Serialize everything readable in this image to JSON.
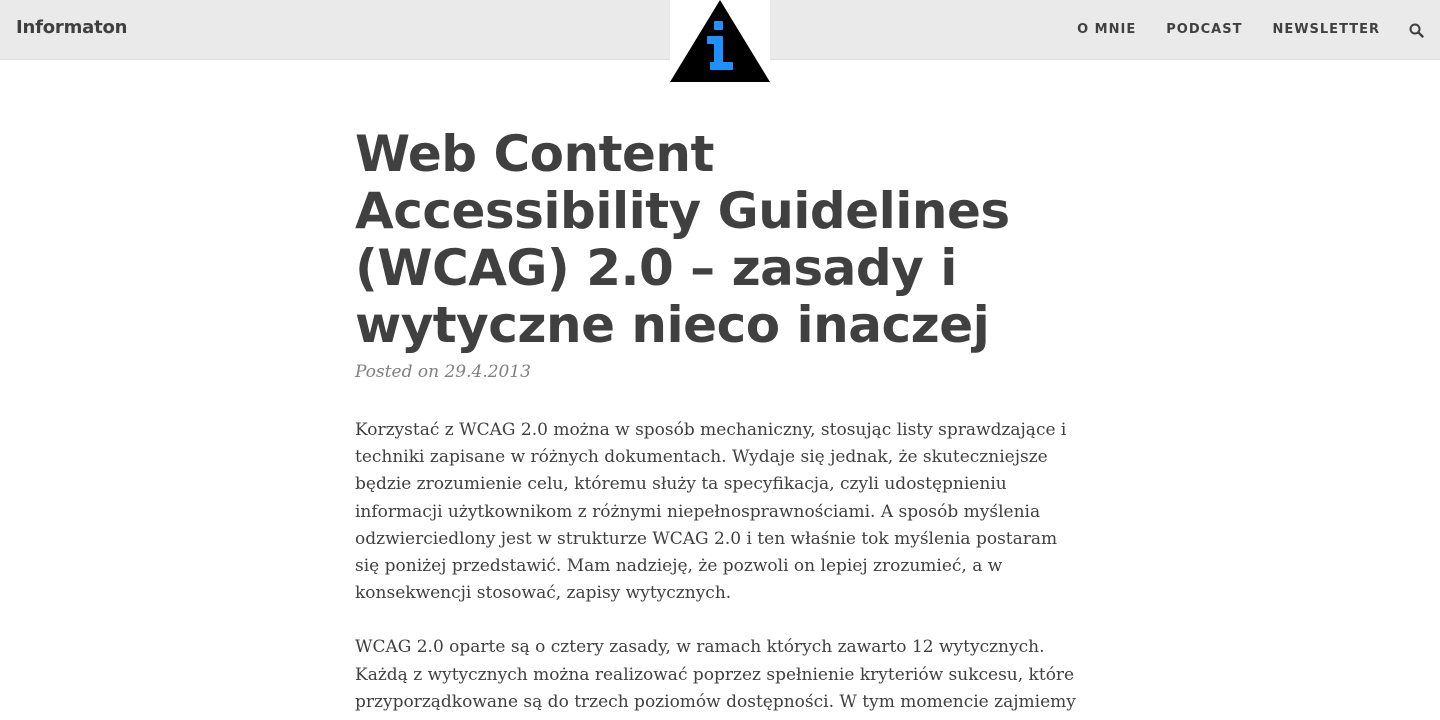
{
  "navbar": {
    "brand": "Informaton",
    "links": [
      {
        "label": "O MNIE"
      },
      {
        "label": "PODCAST"
      },
      {
        "label": "NEWSLETTER"
      }
    ],
    "search_icon": "search-icon",
    "logo_icon": "info-triangle-logo"
  },
  "post": {
    "title": "Web Content Accessibility Guidelines (WCAG) 2.0 – zasady i wytyczne nieco inaczej",
    "meta": "Posted on 29.4.2013",
    "paragraphs": [
      "Korzystać z WCAG 2.0 można w sposób mechaniczny, stosując listy sprawdzające i techniki zapisane w różnych dokumentach. Wydaje się jednak, że skuteczniejsze będzie zrozumienie celu, któremu służy ta specyfikacja, czyli udostępnieniu informacji użytkownikom z różnymi niepełnosprawnościami. A sposób myślenia odzwierciedlony jest w strukturze WCAG 2.0 i ten właśnie tok myślenia postaram się poniżej przedstawić. Mam nadzieję, że pozwoli on lepiej zrozumieć, a w konsekwencji stosować, zapisy wytycznych.",
      "WCAG 2.0 oparte są o cztery zasady, w ramach których zawarto 12 wytycznych. Każdą z wytycznych można realizować poprzez spełnienie kryteriów sukcesu, które przyporządkowane są do trzech poziomów dostępności. W tym momencie zajmiemy"
    ]
  },
  "colors": {
    "navbar_bg": "#eaeaea",
    "text": "#404040",
    "meta": "#808080",
    "logo_accent": "#1e90ff"
  }
}
